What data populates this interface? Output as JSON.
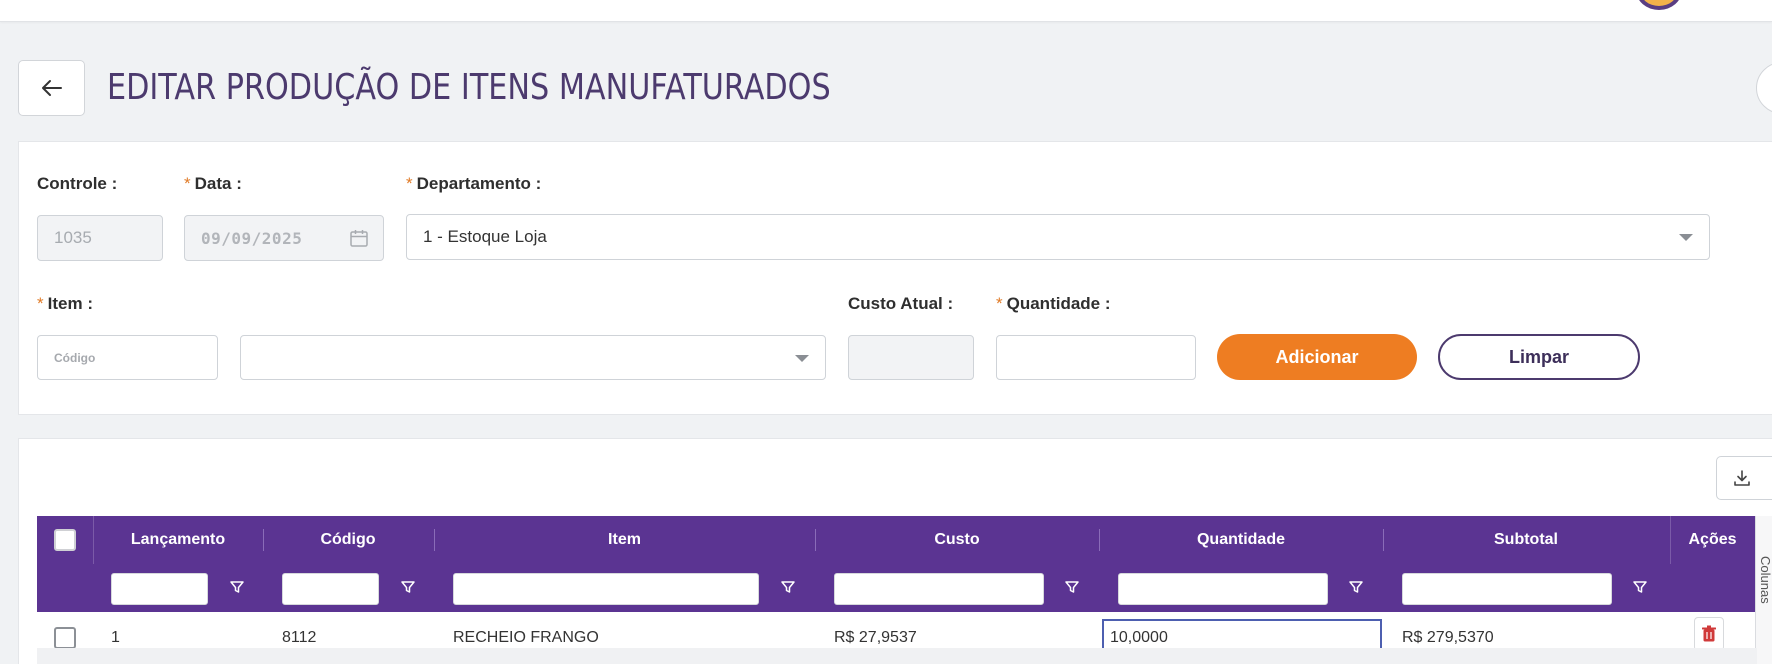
{
  "page": {
    "title": "EDITAR PRODUÇÃO DE ITENS MANUFATURADOS"
  },
  "form": {
    "controle": {
      "label": "Controle",
      "value": "1035"
    },
    "data": {
      "label": "Data",
      "value": "09/09/2025"
    },
    "departamento": {
      "label": "Departamento",
      "value": "1 - Estoque Loja"
    },
    "item": {
      "label": "Item",
      "codigo_placeholder": "Código",
      "value": ""
    },
    "custo_atual": {
      "label": "Custo Atual",
      "value": ""
    },
    "quantidade": {
      "label": "Quantidade",
      "value": ""
    },
    "adicionar_label": "Adicionar",
    "limpar_label": "Limpar",
    "colon": ":"
  },
  "table": {
    "headers": {
      "lancamento": "Lançamento",
      "codigo": "Código",
      "item": "Item",
      "custo": "Custo",
      "quantidade": "Quantidade",
      "subtotal": "Subtotal",
      "acoes": "Ações"
    },
    "rows": [
      {
        "lancamento": "1",
        "codigo": "8112",
        "item": "RECHEIO FRANGO",
        "custo": "R$ 27,9537",
        "quantidade": "10,0000",
        "subtotal": "R$ 279,5370"
      }
    ],
    "columns_panel_label": "Colunas"
  },
  "colors": {
    "primary_purple": "#5b3492",
    "title_purple": "#4c3a6e",
    "accent_orange": "#ee7d22",
    "required_orange": "#e07a26",
    "delete_red": "#d03a3a"
  },
  "icons": {
    "back": "arrow-left-icon",
    "calendar": "calendar-icon",
    "dropdown": "chevron-down-icon",
    "export": "download-icon",
    "filter": "filter-icon",
    "delete": "trash-icon"
  }
}
